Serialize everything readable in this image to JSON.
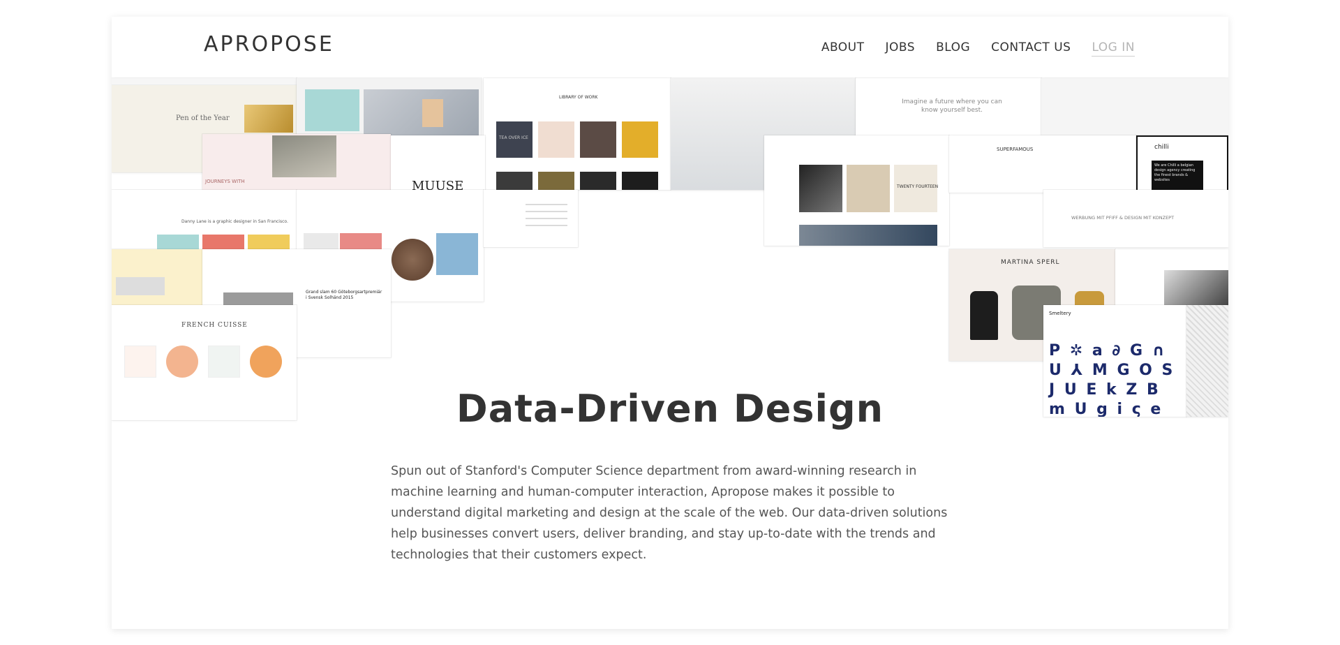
{
  "header": {
    "logo": "APROPOSE",
    "nav": [
      {
        "label": "ABOUT"
      },
      {
        "label": "JOBS"
      },
      {
        "label": "BLOG"
      },
      {
        "label": "CONTACT US"
      },
      {
        "label": "LOG IN"
      }
    ]
  },
  "collage": {
    "pen_title": "Pen of the Year",
    "library": "LIBRARY OF WORK",
    "tea_tile": "TEA OVER ICE",
    "imagine": "Imagine a future where you can know yourself best.",
    "journeys": "JOURNEYS WITH",
    "muuse": "MUUSE",
    "superfamous": "SUPERFAMOUS",
    "chilli": "chilli",
    "chilli_text": "We are Chilli a belgian design agency creating the finest brands & websites",
    "designer": "Danny Lane is a graphic designer in San Francisco.",
    "werbung": "WERBUNG MIT PFIFF & DESIGN MIT KONZEPT",
    "martina": "MARTINA SPERL",
    "french": "FRENCH CUISSE",
    "grand": "Grand slam 60 Göteborgsartpremiär i Svensk Solhänd 2015",
    "twenty": "TWENTY FOURTEEN",
    "smeltery": "Smeltery",
    "glyphs": "P ✲ a ∂ G ∩ U ⅄ M G O S J U E k Z B m U g i ς e ≈"
  },
  "main": {
    "headline": "Data-Driven Design",
    "body": "Spun out of Stanford's Computer Science department from award-winning research in machine learning and human-computer interaction, Apropose makes it possible to understand digital marketing and design at the scale of the web. Our data-driven solutions help businesses convert users, deliver branding, and stay up-to-date with the trends and technologies that their customers expect."
  },
  "colors": {
    "text": "#333333",
    "login_muted": "#b5b5b5",
    "gold": "#e3ae2a",
    "navy": "#1c2a6b",
    "coral": "#e8776a",
    "mint": "#a8d8d6"
  }
}
